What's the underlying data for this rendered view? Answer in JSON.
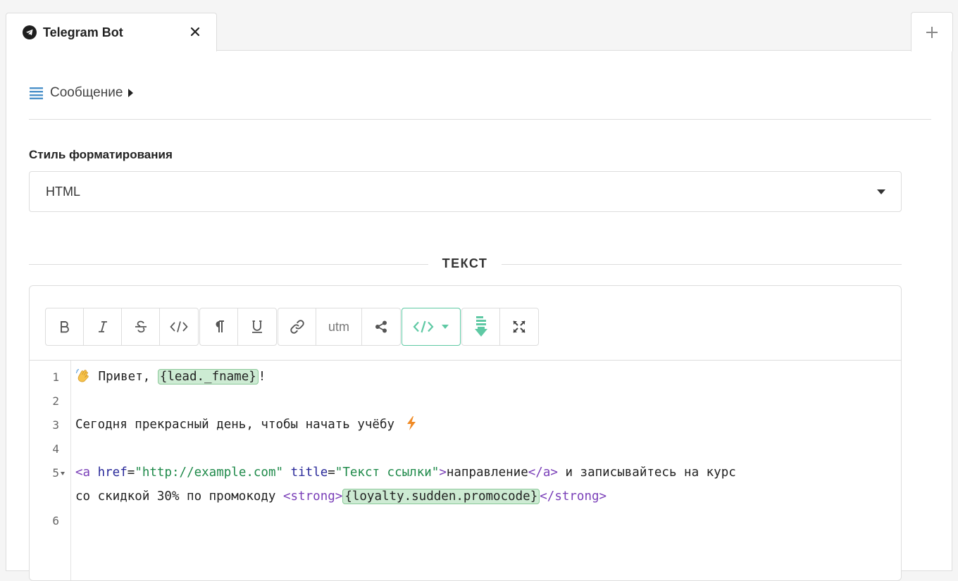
{
  "tabs": [
    {
      "title": "Telegram Bot",
      "active": true
    }
  ],
  "add_tab_label": "+",
  "message_section": {
    "label": "Сообщение"
  },
  "formatting": {
    "label": "Стиль форматирования",
    "selected": "HTML"
  },
  "text_section": {
    "title": "ТЕКСТ"
  },
  "toolbar": {
    "utm_label": "utm",
    "accent_color": "#5fc9a4"
  },
  "code": {
    "line_numbers": [
      "1",
      "2",
      "3",
      "4",
      "5",
      "6"
    ],
    "line1": {
      "prefix": " Привет, ",
      "var": "{lead._fname}",
      "suffix": "!"
    },
    "line3": {
      "text": "Сегодня прекрасный день, чтобы начать учёбу "
    },
    "line5": {
      "tag_open": "<a ",
      "attr_href": "href",
      "eq1": "=",
      "href_val": "\"http://example.com\"",
      "attr_title": " title",
      "eq2": "=",
      "title_val": "\"Текст ссылки\"",
      "tag_close": ">",
      "link_text": "направление",
      "tag_end": "</a>",
      "rest": " и записывайтесь на курс"
    },
    "line5b": {
      "text": "со скидкой 30% по промокоду ",
      "strong_open": "<strong>",
      "var": "{loyalty.sudden.promocode}",
      "strong_close": "</strong>"
    }
  }
}
